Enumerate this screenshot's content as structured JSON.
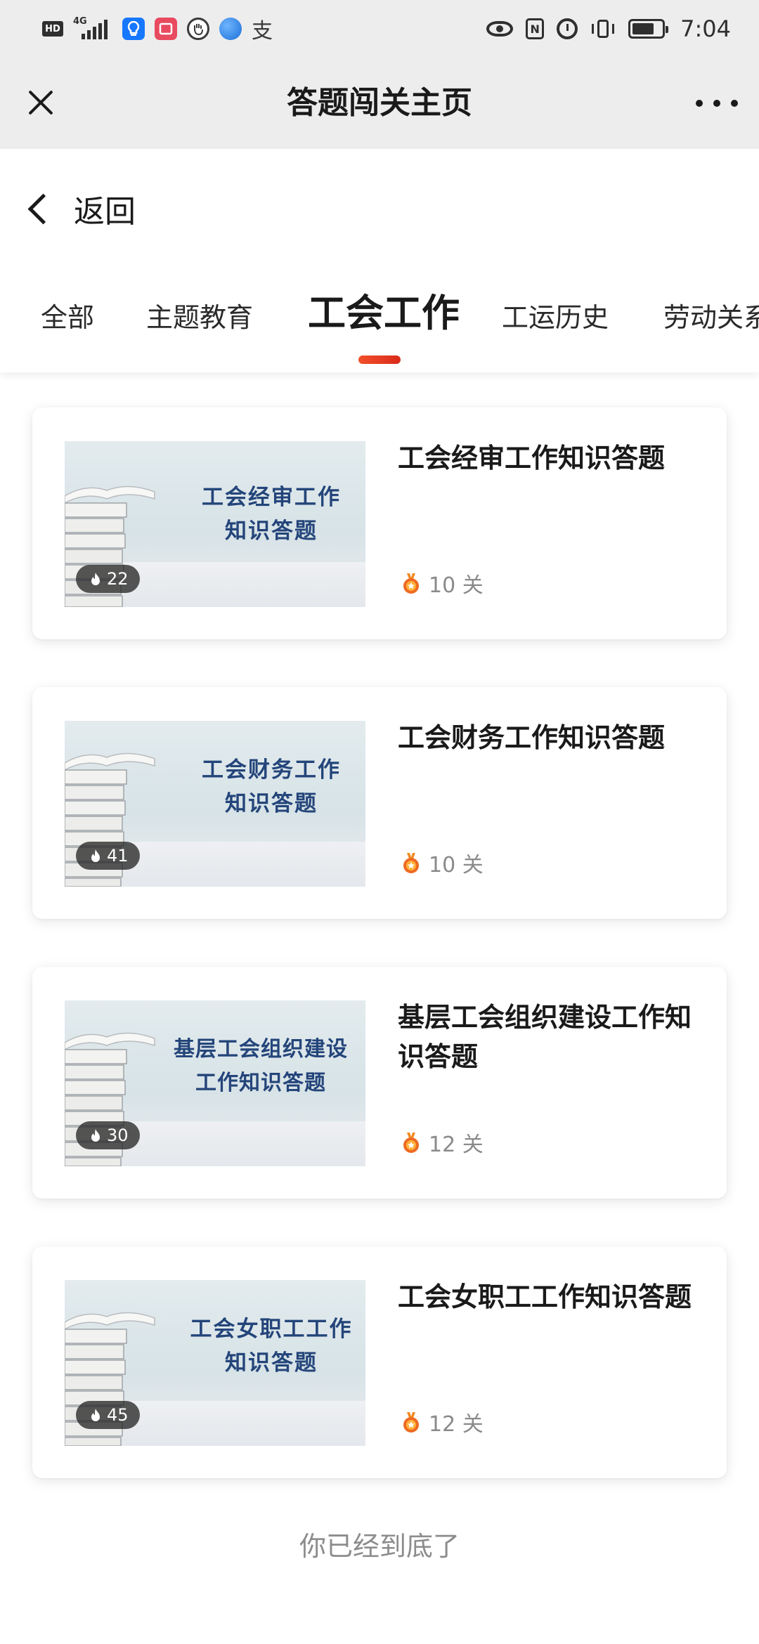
{
  "status_bar": {
    "hd_badge": "HD",
    "network": "4G",
    "zhi_glyph": "支",
    "nfc_label": "N",
    "battery_level": 0.75,
    "time": "7:04"
  },
  "title_bar": {
    "title": "答题闯关主页"
  },
  "back": {
    "label": "返回"
  },
  "tabs": [
    {
      "label": "全部",
      "active": false
    },
    {
      "label": "主题教育",
      "active": false
    },
    {
      "label": "工会工作",
      "active": true
    },
    {
      "label": "工运历史",
      "active": false
    },
    {
      "label": "劳动关系",
      "active": false
    }
  ],
  "quizzes": [
    {
      "thumb_line1": "工会经审工作",
      "thumb_line2": "知识答题",
      "heat": "22",
      "title": "工会经审工作知识答题",
      "levels": "10 关"
    },
    {
      "thumb_line1": "工会财务工作",
      "thumb_line2": "知识答题",
      "heat": "41",
      "title": "工会财务工作知识答题",
      "levels": "10 关"
    },
    {
      "thumb_line1": "基层工会组织建设",
      "thumb_line2": "工作知识答题",
      "heat": "30",
      "title": "基层工会组织建设工作知识答题",
      "levels": "12 关"
    },
    {
      "thumb_line1": "工会女职工工作",
      "thumb_line2": "知识答题",
      "heat": "45",
      "title": "工会女职工工作知识答题",
      "levels": "12 关"
    }
  ],
  "footer": {
    "end_text": "你已经到底了"
  },
  "colors": {
    "accent": "#e8401f",
    "thumb_title": "#24457a",
    "muted_text": "#8a8a8a"
  }
}
